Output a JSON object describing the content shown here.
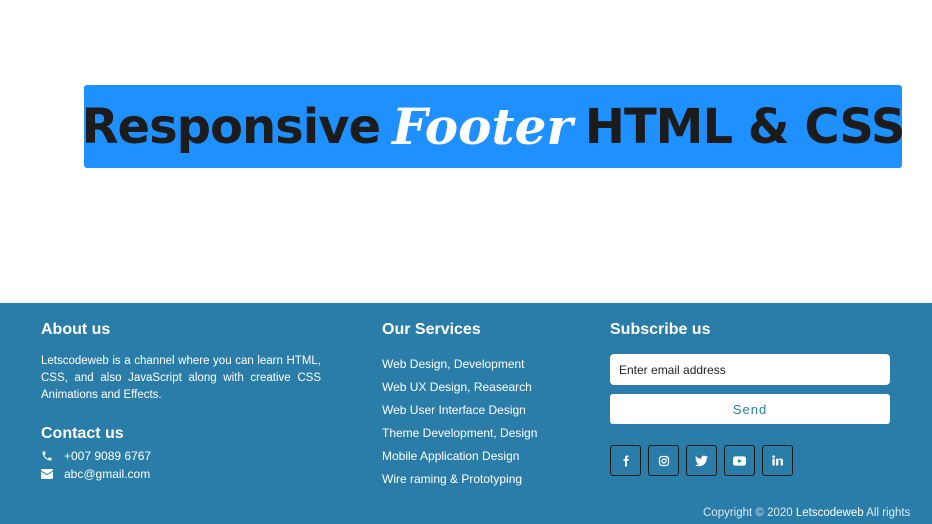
{
  "banner": {
    "word1": "Responsive",
    "word2": "Footer",
    "word3": "HTML & CSS"
  },
  "footer": {
    "about": {
      "title": "About us",
      "text": "Letscodeweb is a channel where you can learn HTML, CSS, and also JavaScript along with creative CSS Animations and Effects."
    },
    "contact": {
      "title": "Contact us",
      "phone": "+007 9089 6767",
      "email": "abc@gmail.com"
    },
    "services": {
      "title": "Our Services",
      "items": [
        "Web Design, Development",
        "Web UX Design, Reasearch",
        "Web User Interface Design",
        "Theme Development, Design",
        "Mobile Application Design",
        "Wire raming & Prototyping"
      ]
    },
    "subscribe": {
      "title": "Subscribe us",
      "placeholder": "Enter email address",
      "button_label": "Send",
      "socials": [
        "facebook-icon",
        "instagram-icon",
        "twitter-icon",
        "youtube-icon",
        "linkedin-icon"
      ]
    },
    "copyright": {
      "prefix": "Copyright © 2020",
      "brand": "Letscodeweb",
      "suffix": "All rights"
    }
  },
  "colors": {
    "banner_bg": "#1e90ff",
    "footer_bg": "#2a7da8",
    "send_text": "#2a7da8"
  }
}
